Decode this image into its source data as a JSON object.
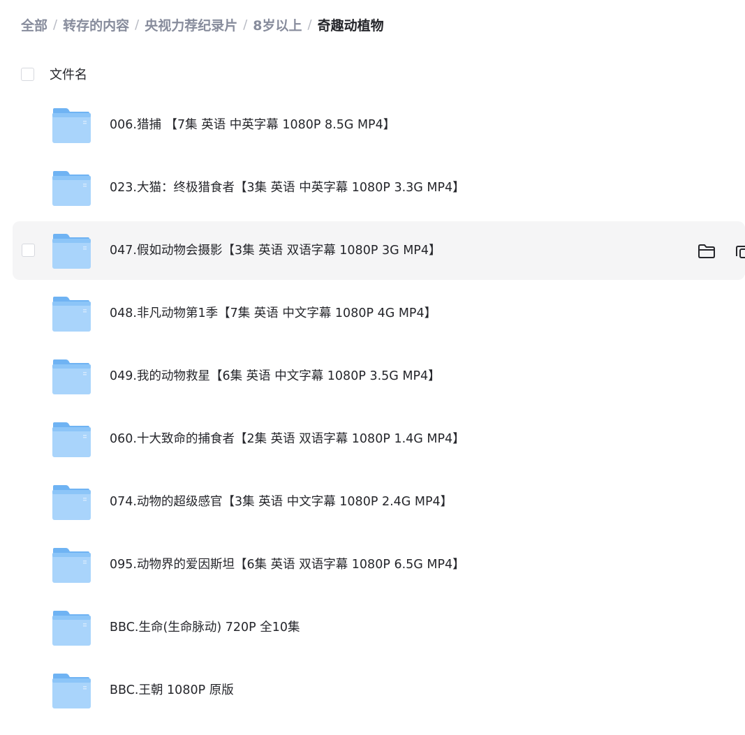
{
  "breadcrumb": {
    "items": [
      "全部",
      "转存的内容",
      "央视力荐纪录片",
      "8岁以上"
    ],
    "current": "奇趣动植物",
    "separator": "/"
  },
  "list_header": {
    "column_label": "文件名"
  },
  "files": [
    {
      "name": "006.猎捕 【7集 英语 中英字幕 1080P 8.5G MP4】"
    },
    {
      "name": "023.大猫：终极猎食者【3集 英语 中英字幕 1080P 3.3G MP4】"
    },
    {
      "name": "047.假如动物会摄影【3集 英语 双语字幕 1080P 3G MP4】"
    },
    {
      "name": "048.非凡动物第1季【7集 英语 中文字幕 1080P 4G MP4】"
    },
    {
      "name": "049.我的动物救星【6集 英语 中文字幕 1080P 3.5G MP4】"
    },
    {
      "name": "060.十大致命的捕食者【2集 英语  双语字幕 1080P 1.4G MP4】"
    },
    {
      "name": "074.动物的超级感官【3集 英语 中文字幕 1080P 2.4G MP4】"
    },
    {
      "name": "095.动物界的爱因斯坦【6集 英语 双语字幕 1080P 6.5G MP4】"
    },
    {
      "name": "BBC.生命(生命脉动) 720P 全10集"
    },
    {
      "name": "BBC.王朝 1080P 原版"
    }
  ],
  "hovered_row_index": 2,
  "icons": {
    "file_icon": "folder-icon",
    "hover_actions": [
      "open-folder-icon",
      "copy-icon"
    ]
  },
  "colors": {
    "folder_light": "#a9d4fb",
    "folder_dark": "#6fb3f3",
    "row_hover": "#f5f5f6",
    "text_primary": "#25262b",
    "text_secondary": "#878c9c"
  }
}
